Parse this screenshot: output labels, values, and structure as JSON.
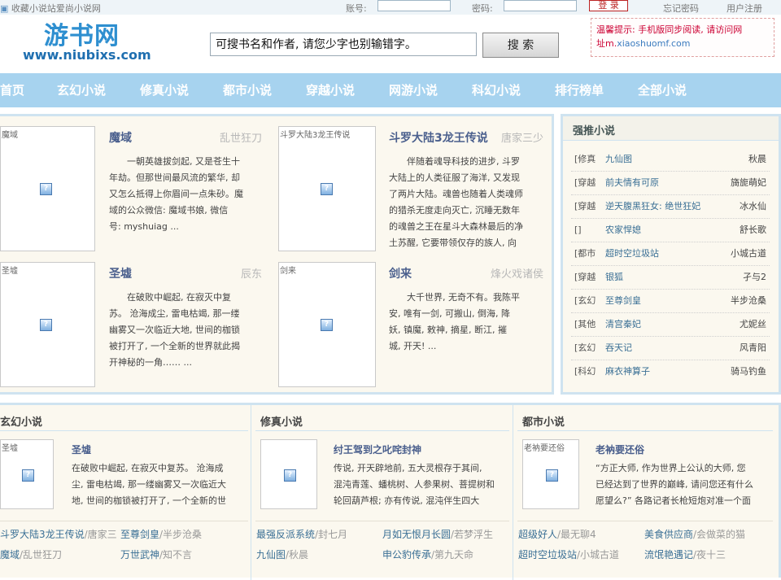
{
  "topbar": {
    "bookmark": "收藏小说站爱尚小说网",
    "account_label": "账号:",
    "password_label": "密码:",
    "login_btn": "登 录",
    "forgot": "忘记密码",
    "register": "用户注册"
  },
  "header": {
    "logo_cn": "游书网",
    "logo_en": "www.niubixs.com",
    "search_value": "可搜书名和作者, 请您少字也别输错字。",
    "search_btn": "搜 索",
    "notice_line1": "温馨提示: 手机版同步阅读, 请访问网",
    "notice_line2a": "址m.",
    "notice_line2b": "xiaoshuomf.com"
  },
  "nav": [
    "首页",
    "玄幻小说",
    "修真小说",
    "都市小说",
    "穿越小说",
    "网游小说",
    "科幻小说",
    "排行榜单",
    "全部小说"
  ],
  "featured": [
    {
      "cover": "魔域",
      "title": "魔域",
      "author": "乱世狂刀",
      "desc": [
        "一朝英雄拔剑起, 又是苍生十",
        "年劫。但那世间最风流的繁华, 却",
        "又怎么抵得上你眉间一点朱砂。魔",
        "域的公众微信: 魔域书娘, 微信",
        "号: myshuiag ..."
      ]
    },
    {
      "cover": "斗罗大陆3龙王传说",
      "title": "斗罗大陆3龙王传说",
      "author": "唐家三少",
      "desc": [
        "伴随着魂导科技的进步, 斗罗",
        "大陆上的人类征服了海洋, 又发现",
        "了两片大陆。魂兽也随着人类魂师",
        "的猎杀无度走向灭亡, 沉睡无数年",
        "的魂兽之王在星斗大森林最后的净",
        "土苏醒, 它要带领仅存的族人, 向"
      ]
    },
    {
      "cover": "圣墟",
      "title": "圣墟",
      "author": "辰东",
      "desc": [
        "在破败中崛起, 在寂灭中复",
        "苏。 沧海成尘, 雷电枯竭, 那一缕",
        "幽雾又一次临近大地, 世间的枷锁",
        "被打开了, 一个全新的世界就此揭",
        "开神秘的一角…… ..."
      ]
    },
    {
      "cover": "剑来",
      "title": "剑来",
      "author": "烽火戏诸侯",
      "desc": [
        "大千世界, 无奇不有。我陈平",
        "安, 唯有一剑, 可搬山, 倒海, 降",
        "妖, 镇魔, 敕神, 摘星, 断江, 摧",
        "城, 开天! ..."
      ]
    }
  ],
  "recommend": {
    "title": "强推小说",
    "rows": [
      {
        "cat": "[修真",
        "name": "九仙图",
        "author": "秋晨"
      },
      {
        "cat": "[穿越",
        "name": "前夫情有可原",
        "author": "旖旎萌妃"
      },
      {
        "cat": "[穿越",
        "name": "逆天腹黑狂女: 绝世狂妃",
        "author": "冰水仙"
      },
      {
        "cat": "[]",
        "name": "农家悍媳",
        "author": "舒长歌"
      },
      {
        "cat": "[都市",
        "name": "超时空垃圾站",
        "author": "小城古道"
      },
      {
        "cat": "[穿越",
        "name": "银狐",
        "author": "孑与2"
      },
      {
        "cat": "[玄幻",
        "name": "至尊剑皇",
        "author": "半步沧桑"
      },
      {
        "cat": "[其他",
        "name": "清宫秦妃",
        "author": "尤妮丝"
      },
      {
        "cat": "[玄幻",
        "name": "吞天记",
        "author": "风青阳"
      },
      {
        "cat": "[科幻",
        "name": "麻衣神算子",
        "author": "骑马钓鱼"
      }
    ]
  },
  "sections": [
    {
      "head": "玄幻小说",
      "cover": "圣墟",
      "title": "圣墟",
      "desc": [
        "在破败中崛起, 在寂灭中复苏。 沧海成",
        "尘, 雷电枯竭, 那一缕幽雾又一次临近大",
        "地, 世间的枷锁被打开了, 一个全新的世"
      ],
      "links": [
        {
          "t": "斗罗大陆3龙王传说",
          "a": "/唐家三"
        },
        {
          "t": "至尊剑皇",
          "a": "/半步沧桑"
        },
        {
          "t": "魔域",
          "a": "/乱世狂刀"
        },
        {
          "t": "万世武神",
          "a": "/知不言"
        }
      ]
    },
    {
      "head": "修真小说",
      "cover": "",
      "title": "纣王驾到之叱咤封神",
      "desc": [
        "传说, 开天辟地前, 五大灵根存于其间,",
        "混沌青莲、蟠桃树、人参果树、菩提树和",
        "轮回葫芦根; 亦有传说, 混沌伴生四大"
      ],
      "links": [
        {
          "t": "最强反派系统",
          "a": "/封七月"
        },
        {
          "t": "月如无恨月长圆",
          "a": "/若梦浮生"
        },
        {
          "t": "九仙图",
          "a": "/秋晨"
        },
        {
          "t": "申公豹传承",
          "a": "/第九天命"
        }
      ]
    },
    {
      "head": "都市小说",
      "cover": "老衲要还俗",
      "title": "老衲要还俗",
      "desc": [
        "“方正大师, 作为世界上公认的大师, 您",
        "已经达到了世界的巅峰, 请问您还有什么",
        "愿望么?” 各路记者长枪短炮对准一个面"
      ],
      "links": [
        {
          "t": "超级好人",
          "a": "/最无聊4"
        },
        {
          "t": "美食供应商",
          "a": "/会做菜的猫"
        },
        {
          "t": "超时空垃圾站",
          "a": "/小城古道"
        },
        {
          "t": "流氓艳遇记",
          "a": "/夜十三"
        }
      ]
    }
  ]
}
